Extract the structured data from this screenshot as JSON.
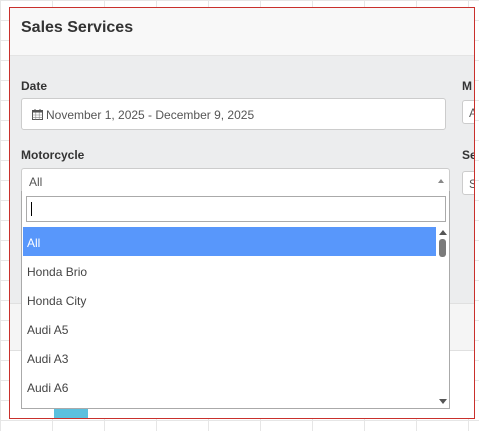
{
  "dialog": {
    "title": "Sales Services"
  },
  "date": {
    "label": "Date",
    "value": "November 1, 2025 - December 9, 2025",
    "icon": "calendar-icon"
  },
  "motorcycle": {
    "label": "Motorcycle",
    "selected": "All",
    "search_value": "",
    "options": [
      "All",
      "Honda Brio",
      "Honda City",
      "Audi A5",
      "Audi A3",
      "Audi A6"
    ]
  },
  "right_column": {
    "label_1": "M",
    "box_1": "A",
    "label_2": "Se",
    "box_2": "S"
  },
  "colors": {
    "highlight": "#5897fb",
    "dialog_border": "#c9302c",
    "chip": "#5bc0de"
  }
}
